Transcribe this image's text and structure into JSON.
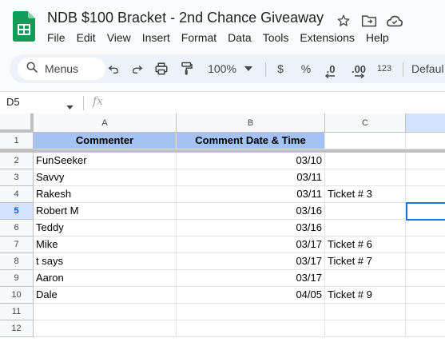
{
  "document": {
    "title": "NDB $100 Bracket - 2nd Chance Giveaway"
  },
  "menu": [
    "File",
    "Edit",
    "View",
    "Insert",
    "Format",
    "Data",
    "Tools",
    "Extensions",
    "Help"
  ],
  "toolbar": {
    "search_label": "Menus",
    "zoom": "100%",
    "currency": "$",
    "percent": "%",
    "decrease_decimal": ".0",
    "increase_decimal": ".00",
    "number_format": "123",
    "font": "Defaul"
  },
  "formula_bar": {
    "name_box": "D5",
    "fx_label": "fx"
  },
  "grid": {
    "columns": [
      "A",
      "B",
      "C"
    ],
    "row_numbers": [
      "1",
      "2",
      "3",
      "4",
      "5",
      "6",
      "7",
      "8",
      "9",
      "10",
      "11",
      "12"
    ],
    "selected_row": "5",
    "header_row": {
      "a": "Commenter",
      "b": "Comment Date & Time"
    },
    "rows": [
      {
        "a": "FunSeeker",
        "b": "03/10",
        "c": ""
      },
      {
        "a": "Savvy",
        "b": "03/11",
        "c": ""
      },
      {
        "a": "Rakesh",
        "b": "03/11",
        "c": "Ticket # 3"
      },
      {
        "a": "Robert M",
        "b": "03/16",
        "c": ""
      },
      {
        "a": "Teddy",
        "b": "03/16",
        "c": ""
      },
      {
        "a": "Mike",
        "b": "03/17",
        "c": "Ticket # 6"
      },
      {
        "a": "t says",
        "b": "03/17",
        "c": "Ticket # 7"
      },
      {
        "a": "Aaron",
        "b": "03/17",
        "c": ""
      },
      {
        "a": "Dale",
        "b": "04/05",
        "c": "Ticket # 9"
      },
      {
        "a": "",
        "b": "",
        "c": ""
      },
      {
        "a": "",
        "b": "",
        "c": ""
      }
    ]
  },
  "colors": {
    "header_fill": "#a4c2f4",
    "selection_blue": "#1a73e8",
    "sheets_green": "#0f9d58"
  }
}
